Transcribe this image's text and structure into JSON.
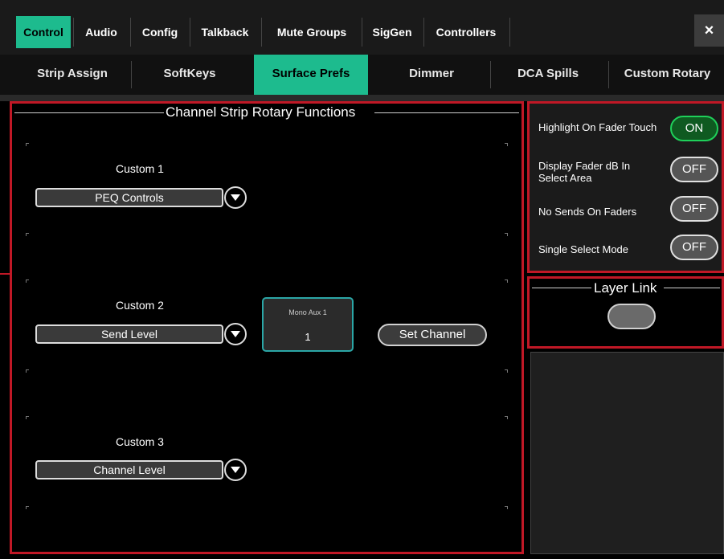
{
  "top_tabs": [
    "Control",
    "Audio",
    "Config",
    "Talkback",
    "Mute Groups",
    "SigGen",
    "Controllers"
  ],
  "close_label": "×",
  "sub_tabs": [
    "Strip Assign",
    "SoftKeys",
    "Surface Prefs",
    "Dimmer",
    "DCA Spills",
    "Custom Rotary"
  ],
  "rotary": {
    "title": "Channel Strip Rotary Functions",
    "custom": [
      {
        "label": "Custom 1",
        "value": "PEQ Controls"
      },
      {
        "label": "Custom 2",
        "value": "Send Level"
      },
      {
        "label": "Custom 3",
        "value": "Channel Level"
      }
    ],
    "channel_name": "Mono Aux 1",
    "channel_number": "1",
    "set_channel_label": "Set Channel"
  },
  "prefs": [
    {
      "label": "Highlight On Fader Touch",
      "state": "ON"
    },
    {
      "label": "Display Fader dB In Select Area",
      "state": "OFF"
    },
    {
      "label": "No Sends On Faders",
      "state": "OFF"
    },
    {
      "label": "Single Select Mode",
      "state": "OFF"
    }
  ],
  "layer_link": {
    "title": "Layer Link"
  },
  "colors": {
    "accent": "#1dbb8e",
    "highlight_border": "#c01826",
    "on_green": "#1fd05a"
  }
}
